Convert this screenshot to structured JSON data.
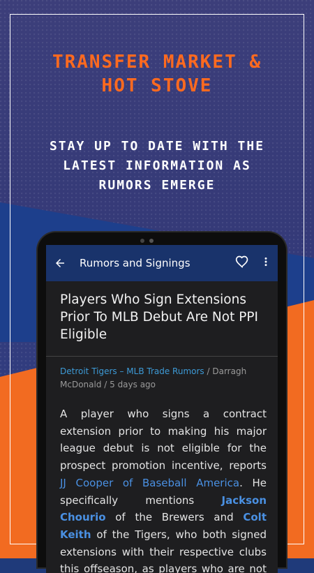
{
  "headline": {
    "line1": "TRANSFER MARKET &",
    "line2": "HOT STOVE"
  },
  "subheadline": {
    "line1": "STAY UP TO DATE WITH THE",
    "line2": "LATEST INFORMATION AS",
    "line3": "RUMORS EMERGE"
  },
  "appbar": {
    "title": "Rumors and Signings",
    "back_icon": "arrow-left-icon",
    "favorite_icon": "heart-outline-icon",
    "menu_icon": "more-vertical-icon"
  },
  "article": {
    "title": "Players Who Sign Extensions Prior To MLB Debut Are Not PPI Eligible",
    "source": "Detroit Tigers – MLB Trade Rumors",
    "byline": " / Darragh McDonald / 5 days ago",
    "body": {
      "p1": "A player who signs a contract extension prior to making his major league debut is not eligible for the prospect promotion incentive, reports ",
      "link1": "JJ Cooper of Baseball America",
      "p2": ". He specifically mentions ",
      "player1": "Jackson Chourio",
      "p3": " of the Brewers and ",
      "player2": "Colt Keith",
      "p4": " of the Tigers, who both signed extensions with their respective clubs this offseason, as players who are not PPI eligible."
    }
  },
  "colors": {
    "orange": "#f26b21",
    "navy": "#19336b",
    "link_blue": "#4a90e2",
    "source_blue": "#3d9ad6"
  }
}
